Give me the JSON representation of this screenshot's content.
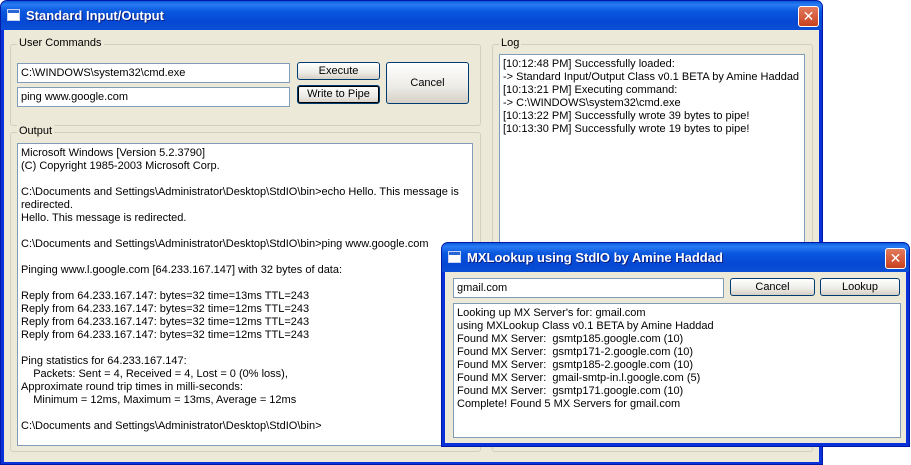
{
  "main_window": {
    "title": "Standard Input/Output",
    "user_commands_label": "User Commands",
    "command_value": "C:\\WINDOWS\\system32\\cmd.exe",
    "pipe_value": "ping www.google.com",
    "execute_label": "Execute",
    "write_label": "Write to Pipe",
    "cancel_label": "Cancel",
    "output_label": "Output",
    "output_lines": [
      "Microsoft Windows [Version 5.2.3790]",
      "(C) Copyright 1985-2003 Microsoft Corp.",
      "",
      "C:\\Documents and Settings\\Administrator\\Desktop\\StdIO\\bin>echo Hello. This message is",
      "redirected.",
      "Hello. This message is redirected.",
      "",
      "C:\\Documents and Settings\\Administrator\\Desktop\\StdIO\\bin>ping www.google.com",
      "",
      "Pinging www.l.google.com [64.233.167.147] with 32 bytes of data:",
      "",
      "Reply from 64.233.167.147: bytes=32 time=13ms TTL=243",
      "Reply from 64.233.167.147: bytes=32 time=12ms TTL=243",
      "Reply from 64.233.167.147: bytes=32 time=12ms TTL=243",
      "Reply from 64.233.167.147: bytes=32 time=12ms TTL=243",
      "",
      "Ping statistics for 64.233.167.147:",
      "    Packets: Sent = 4, Received = 4, Lost = 0 (0% loss),",
      "Approximate round trip times in milli-seconds:",
      "    Minimum = 12ms, Maximum = 13ms, Average = 12ms",
      "",
      "C:\\Documents and Settings\\Administrator\\Desktop\\StdIO\\bin>"
    ],
    "log_label": "Log",
    "log_lines": [
      "[10:12:48 PM] Successfully loaded:",
      "-> Standard Input/Output Class v0.1 BETA by Amine Haddad",
      "[10:13:21 PM] Executing command:",
      "-> C:\\WINDOWS\\system32\\cmd.exe",
      "[10:13:22 PM] Successfully wrote 39 bytes to pipe!",
      "[10:13:30 PM] Successfully wrote 19 bytes to pipe!"
    ]
  },
  "mx_window": {
    "title": "MXLookup using StdIO by Amine Haddad",
    "domain_value": "gmail.com",
    "cancel_label": "Cancel",
    "lookup_label": "Lookup",
    "result_lines": [
      "Looking up MX Server's for: gmail.com",
      "using MXLookup Class v0.1 BETA by Amine Haddad",
      "Found MX Server:  gsmtp185.google.com (10)",
      "Found MX Server:  gsmtp171-2.google.com (10)",
      "Found MX Server:  gsmtp185-2.google.com (10)",
      "Found MX Server:  gmail-smtp-in.l.google.com (5)",
      "Found MX Server:  gsmtp171.google.com (10)",
      "Complete! Found 5 MX Servers for gmail.com"
    ]
  },
  "close_glyph": "✕",
  "colors": {
    "title_blue": "#0a58e0",
    "frame_blue": "#0831d9",
    "close_red": "#c8411e",
    "dialog_bg": "#ece9d8"
  }
}
